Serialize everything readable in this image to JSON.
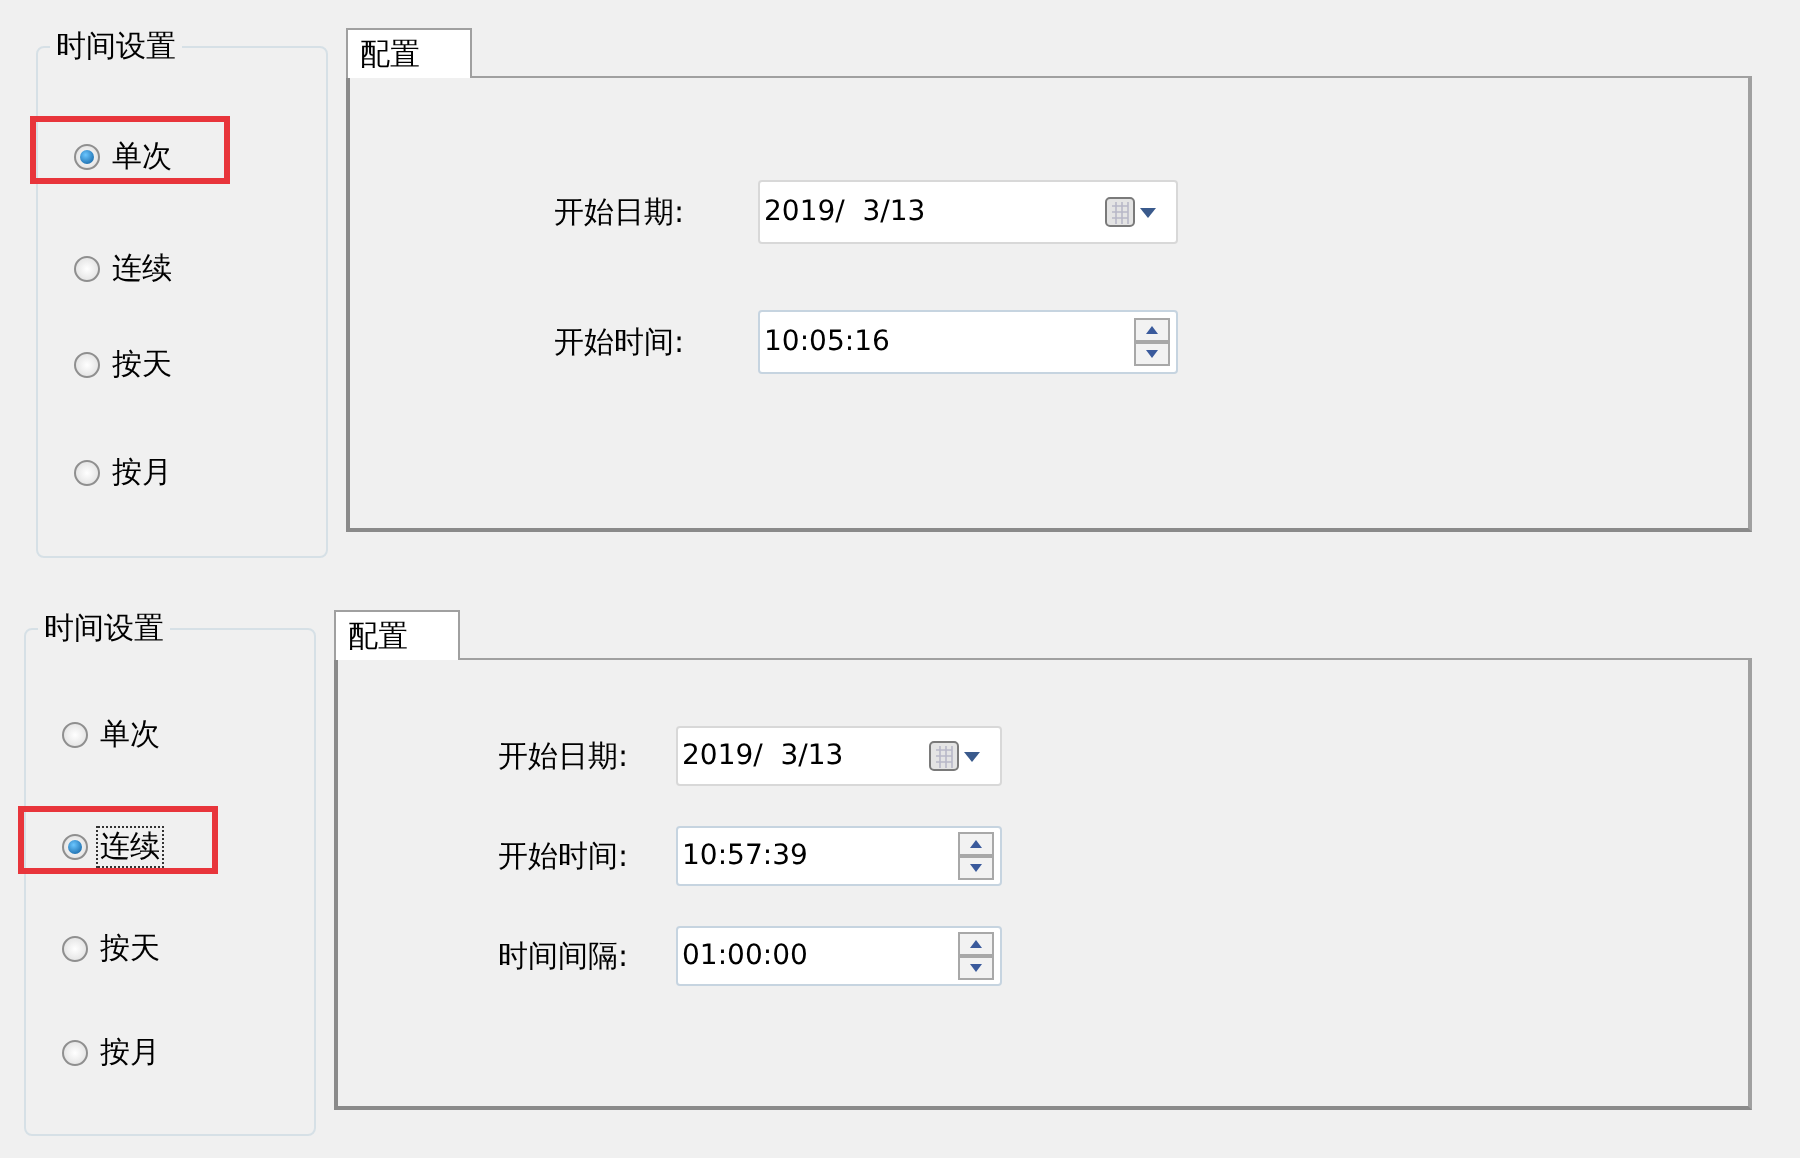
{
  "panels": [
    {
      "group_title": "时间设置",
      "tab": "配置",
      "options": [
        {
          "label": "单次",
          "selected": true,
          "focused": false
        },
        {
          "label": "连续",
          "selected": false,
          "focused": false
        },
        {
          "label": "按天",
          "selected": false,
          "focused": false
        },
        {
          "label": "按月",
          "selected": false,
          "focused": false
        }
      ],
      "fields": [
        {
          "kind": "date",
          "label": "开始日期:",
          "value": "2019/  3/13"
        },
        {
          "kind": "time",
          "label": "开始时间:",
          "value": "10:05:16"
        }
      ]
    },
    {
      "group_title": "时间设置",
      "tab": "配置",
      "options": [
        {
          "label": "单次",
          "selected": false,
          "focused": false
        },
        {
          "label": "连续",
          "selected": true,
          "focused": true
        },
        {
          "label": "按天",
          "selected": false,
          "focused": false
        },
        {
          "label": "按月",
          "selected": false,
          "focused": false
        }
      ],
      "fields": [
        {
          "kind": "date",
          "label": "开始日期:",
          "value": "2019/  3/13"
        },
        {
          "kind": "time",
          "label": "开始时间:",
          "value": "10:57:39"
        },
        {
          "kind": "time",
          "label": "时间间隔:",
          "value": "01:00:00"
        }
      ]
    }
  ]
}
